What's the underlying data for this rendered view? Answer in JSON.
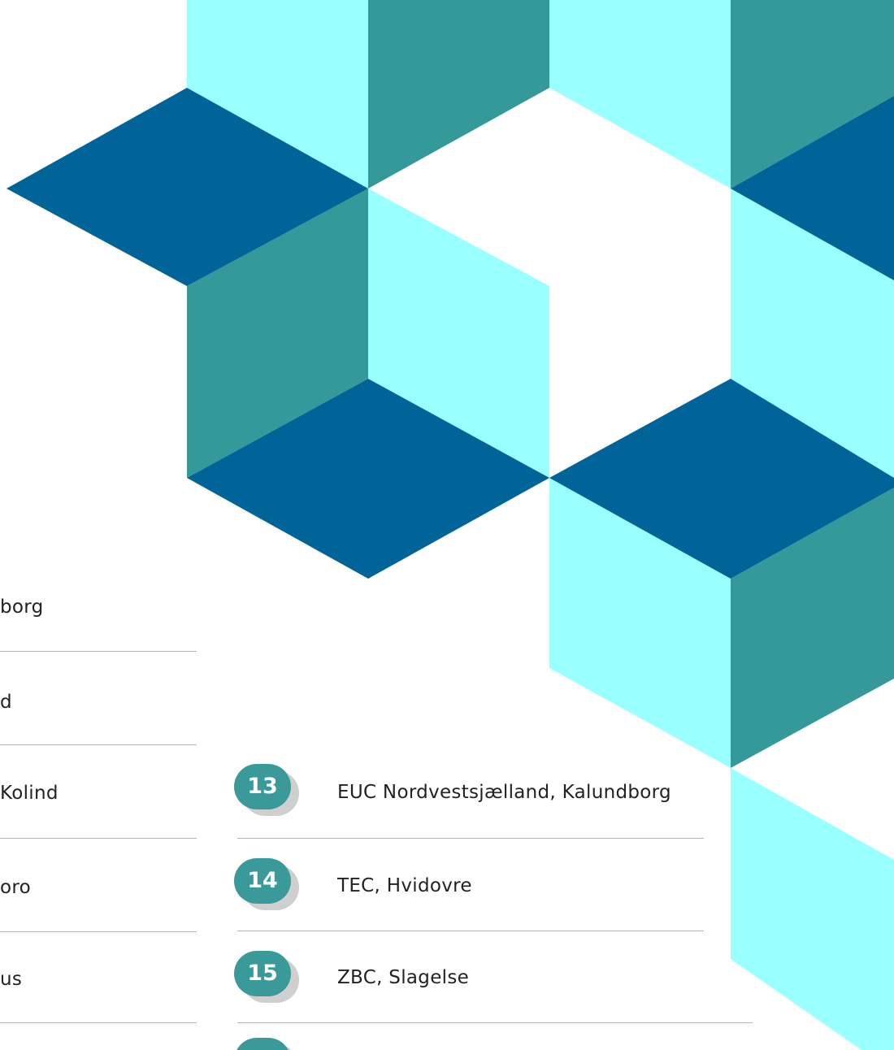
{
  "colors": {
    "dark_blue": "#006499",
    "teal": "#359999",
    "light_cyan": "#99ffff",
    "badge": "#3a9a9a"
  },
  "left_column": [
    "borg",
    "d",
    "Kolind",
    "oro",
    "us"
  ],
  "right_list": [
    {
      "number": "13",
      "name": "EUC Nordvestsjælland, Kalundborg"
    },
    {
      "number": "14",
      "name": "TEC, Hvidovre"
    },
    {
      "number": "15",
      "name": "ZBC, Slagelse"
    },
    {
      "number": "",
      "name": ""
    }
  ]
}
